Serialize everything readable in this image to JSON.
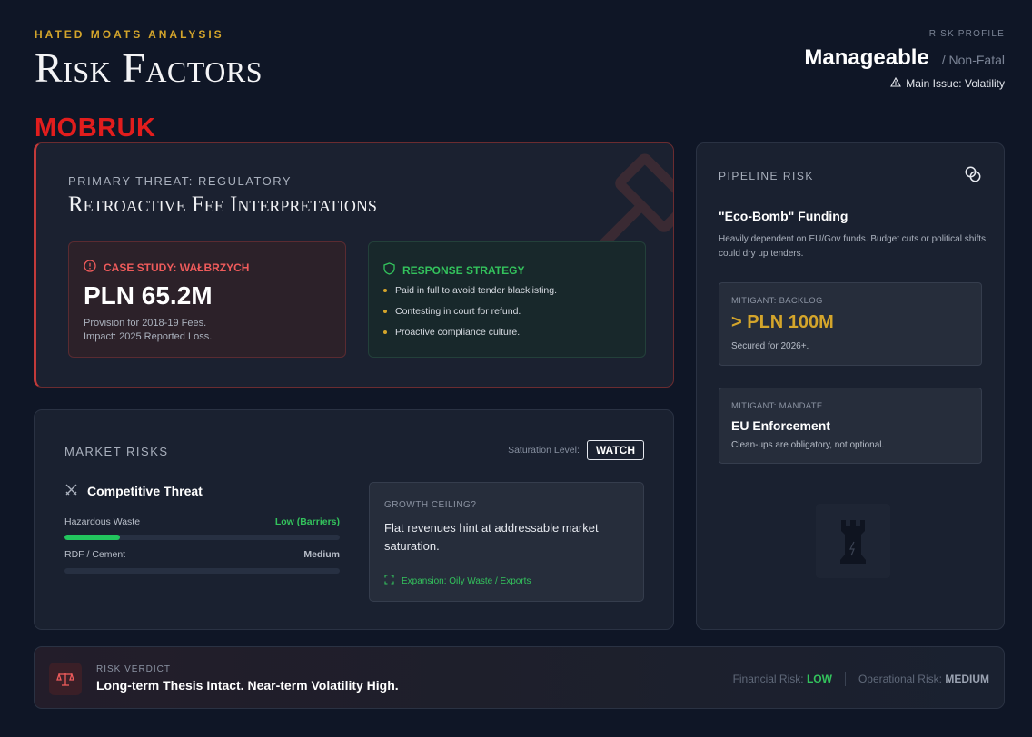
{
  "header": {
    "kicker": "HATED MOATS ANALYSIS",
    "title": "Risk Factors",
    "risk_profile_label": "RISK PROFILE",
    "risk_profile_value": "Manageable",
    "risk_profile_sub": "/ Non-Fatal",
    "main_issue": "Main Issue: Volatility"
  },
  "logo": {
    "text": "MOBRUK",
    "color": "#e11d1d"
  },
  "primary": {
    "label": "PRIMARY THREAT: REGULATORY",
    "title": "Retroactive Fee Interpretations",
    "case": {
      "title": "CASE STUDY: WAŁBRZYCH",
      "amount": "PLN 65.2M",
      "note1": "Provision for 2018-19 Fees.",
      "note2": "Impact: 2025 Reported Loss."
    },
    "response": {
      "title": "RESPONSE STRATEGY",
      "items": [
        "Paid in full to avoid tender blacklisting.",
        "Contesting in court for refund.",
        "Proactive compliance culture."
      ]
    }
  },
  "market": {
    "label": "MARKET RISKS",
    "saturation_label": "Saturation Level:",
    "saturation_value": "WATCH",
    "competitive_title": "Competitive Threat",
    "bars": [
      {
        "name": "Hazardous Waste",
        "value": "Low (Barriers)",
        "level": 0.2,
        "color": "#33c25c"
      },
      {
        "name": "RDF / Cement",
        "value": "Medium",
        "level": 0.0,
        "color": "#b7bdc8"
      }
    ],
    "ceiling": {
      "question": "GROWTH CEILING?",
      "text": "Flat revenues hint at addressable market saturation.",
      "expansion": "Expansion: Oily Waste / Exports"
    }
  },
  "pipeline": {
    "label": "PIPELINE RISK",
    "heading": "\"Eco-Bomb\" Funding",
    "desc": "Heavily dependent on EU/Gov funds. Budget cuts or political shifts could dry up tenders.",
    "mitigant1": {
      "label": "MITIGANT: BACKLOG",
      "value": "> PLN 100M",
      "sub": "Secured for 2026+."
    },
    "mitigant2": {
      "label": "MITIGANT: MANDATE",
      "value": "EU Enforcement",
      "sub": "Clean-ups are obligatory, not optional."
    }
  },
  "verdict": {
    "label": "RISK VERDICT",
    "text": "Long-term Thesis Intact. Near-term Volatility High.",
    "financial_label": "Financial Risk:",
    "financial_value": "LOW",
    "operational_label": "Operational Risk:",
    "operational_value": "MEDIUM"
  }
}
